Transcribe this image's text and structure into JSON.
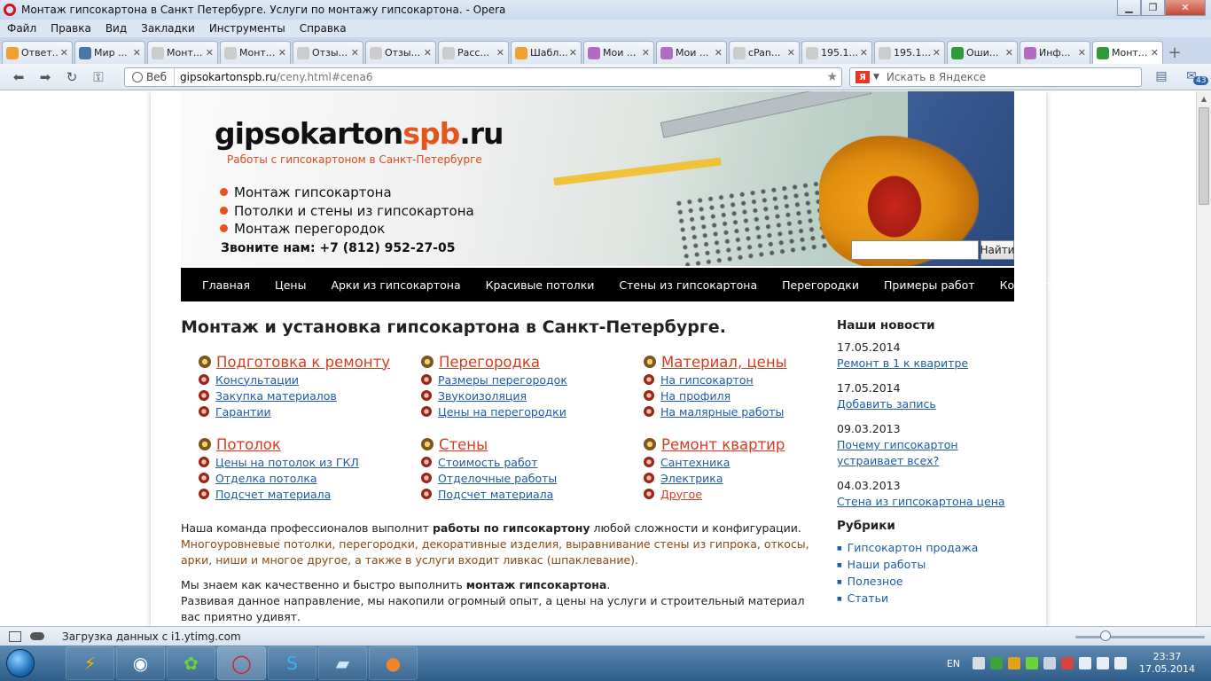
{
  "window": {
    "title": "Монтаж гипсокартона в Санкт Петербурге. Услуги по монтажу гипсокартона. - Opera",
    "minimize": "▁",
    "maximize": "❐",
    "close": "✕"
  },
  "menu": [
    "Файл",
    "Правка",
    "Вид",
    "Закладки",
    "Инструменты",
    "Справка"
  ],
  "tabs": [
    {
      "label": "Ответ...",
      "color": "#f0a030"
    },
    {
      "label": "Мир ...",
      "color": "#4a76a8"
    },
    {
      "label": "Монт...",
      "color": "#cccccc"
    },
    {
      "label": "Монт...",
      "color": "#cccccc"
    },
    {
      "label": "Отзы...",
      "color": "#cccccc"
    },
    {
      "label": "Отзы...",
      "color": "#cccccc"
    },
    {
      "label": "Расс...",
      "color": "#cccccc"
    },
    {
      "label": "Шабл...",
      "color": "#f0a030"
    },
    {
      "label": "Мои ...",
      "color": "#b36ac2"
    },
    {
      "label": "Мои ...",
      "color": "#b36ac2"
    },
    {
      "label": "cPan...",
      "color": "#cccccc"
    },
    {
      "label": "195.1...",
      "color": "#cccccc"
    },
    {
      "label": "195.1...",
      "color": "#cccccc"
    },
    {
      "label": "Оши...",
      "color": "#2e9b3a"
    },
    {
      "label": "Инф...",
      "color": "#b36ac2"
    },
    {
      "label": "Монт...",
      "color": "#2e9b3a",
      "active": true
    }
  ],
  "address": {
    "mode": "Веб",
    "host": "gipsokartonspb.ru",
    "path": "/ceny.html#cena6",
    "search_placeholder": "Искать в Яндексе",
    "mail_count": "43"
  },
  "header": {
    "logo_main": "gipsokarton",
    "logo_accent": "spb",
    "logo_tld": ".ru",
    "tagline": "Работы с гипсокартоном в Санкт-Петербурге",
    "bullets": [
      "Монтаж гипсокартона",
      "Потолки и стены из гипсокартона",
      "Монтаж перегородок"
    ],
    "phone": "Звоните нам: +7 (812) 952-27-05",
    "search_button": "Найти"
  },
  "nav": [
    "Главная",
    "Цены",
    "Арки из гипсокартона",
    "Красивые потолки",
    "Стены из гипсокартона",
    "Перегородки",
    "Примеры работ",
    "Контакты"
  ],
  "main": {
    "heading": "Монтаж и установка гипсокартона в Санкт-Петербурге.",
    "groups": [
      {
        "title": "Подготовка к ремонту",
        "links": [
          "Консультации",
          "Закупка материалов",
          "Гарантии"
        ]
      },
      {
        "title": "Перегородка",
        "links": [
          "Размеры перегородок",
          "Звукоизоляция",
          "Цены на перегородки"
        ]
      },
      {
        "title": "Материал, цены",
        "links": [
          "На гипсокартон",
          "На профиля",
          "На малярные работы"
        ]
      },
      {
        "title": "Потолок",
        "links": [
          "Цены на потолок из ГКЛ",
          "Отделка потолка",
          "Подсчет материала"
        ]
      },
      {
        "title": "Стены",
        "links": [
          "Стоимость работ",
          "Отделочные работы",
          "Подсчет материала"
        ]
      },
      {
        "title": "Ремонт квартир",
        "links": [
          "Сантехника",
          "Электрика",
          "Другое"
        ]
      }
    ],
    "p1_a": "Наша команда профессионалов выполнит ",
    "p1_b": "работы по гипсокартону",
    "p1_c": " любой сложности и конфигурации.",
    "p1_d": "Многоуровневые потолки, перегородки, декоративные изделия, выравнивание стены из гипрока, откосы, арки, ниши и многое другое, а также в услуги входит ливкас (шпаклевание).",
    "p2_a": "Мы знаем как качественно и быстро выполнить ",
    "p2_b": "монтаж гипсокартона",
    "p2_c": ".",
    "p2_d": "Развивая данное направление, мы накопили огромный опыт, а цены на услуги и строительный материал вас приятно удивят."
  },
  "sidebar": {
    "news_title": "Наши новости",
    "news": [
      {
        "date": "17.05.2014",
        "link": "Ремонт в 1 к кваритре"
      },
      {
        "date": "17.05.2014",
        "link": "Добавить запись"
      },
      {
        "date": "09.03.2013",
        "link": "Почему гипсокартон устраивает всех?"
      },
      {
        "date": "04.03.2013",
        "link": "Стена из гипсокартона цена"
      }
    ],
    "rubrics_title": "Рубрики",
    "rubrics": [
      "Гипсокартон продажа",
      "Наши работы",
      "Полезное",
      "Статьи"
    ]
  },
  "status": {
    "text": "Загрузка данных с i1.ytimg.com",
    "zoom_level": 0.23
  },
  "taskbar": {
    "lang": "EN",
    "time": "23:37",
    "date": "17.05.2014",
    "apps": [
      "winamp-icon",
      "media-icon",
      "icq-icon",
      "opera-icon",
      "skype-icon",
      "notepad-icon",
      "firefox-icon"
    ]
  }
}
